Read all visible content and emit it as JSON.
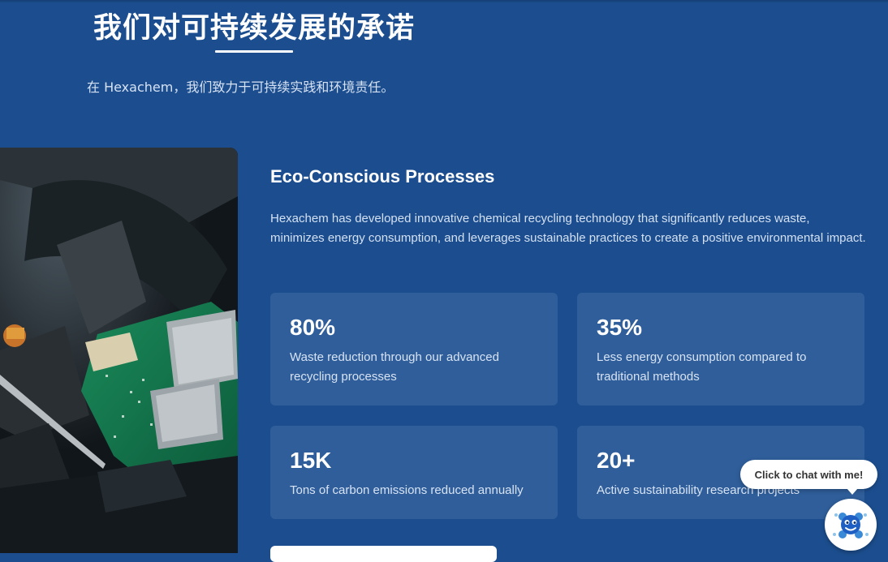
{
  "header": {
    "title": "我们对可持续发展的承诺",
    "subtitle": "在 Hexachem，我们致力于可持续实践和环境责任。"
  },
  "feature": {
    "image_description_icon": "circuit-board-photo",
    "heading": "Eco-Conscious Processes",
    "body": "Hexachem has developed innovative chemical recycling technology that significantly reduces waste, minimizes energy consumption, and leverages sustainable practices to create a positive environmental impact."
  },
  "stats": [
    {
      "value": "80%",
      "description": "Waste reduction through our advanced recycling processes"
    },
    {
      "value": "35%",
      "description": "Less energy consumption compared to traditional methods"
    },
    {
      "value": "15K",
      "description": "Tons of carbon emissions reduced annually"
    },
    {
      "value": "20+",
      "description": "Active sustainability research projects"
    }
  ],
  "chat": {
    "prompt": "Click to chat with me!",
    "icon": "chatbot-avatar-icon"
  },
  "colors": {
    "background": "#1c4e8f",
    "card": "#2f5e9a",
    "text": "#ffffff"
  }
}
